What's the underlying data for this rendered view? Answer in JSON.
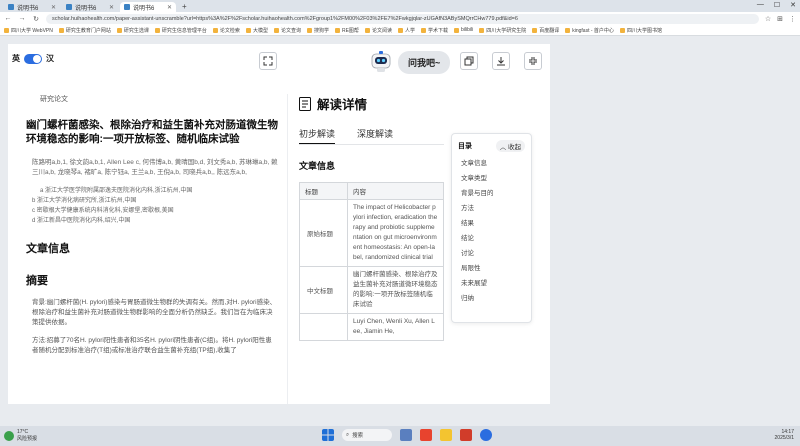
{
  "browser": {
    "tabs": [
      {
        "label": "说明书6",
        "active": false
      },
      {
        "label": "说明书6",
        "active": false
      },
      {
        "label": "说明书6",
        "active": true
      }
    ],
    "url": "scholar.huihaohealth.com/paper-assistant-unscramble?url=https%3A%2F%2Fscholar.huihaohealth.com%2Fgroup1%2FM00%2F03%2FE7%2Fwkgjqlar-zUGAfN3ABySMQrrCHw779.pdf&id=6",
    "bookmarks": [
      "四川大学 WebVPN",
      "研究生教育门户网站",
      "研究生选课",
      "研究生信息管理平台",
      "论文检索",
      "大模型",
      "论文查询",
      "搜狗学",
      "RE图帮",
      "论文阅读",
      "人学",
      "学术下载",
      "bilibili",
      "四川大学研究生院",
      "百度翻译",
      "kingfast - 首户中心",
      "四川大学图书馆"
    ]
  },
  "toolbar": {
    "lang_left": "英",
    "lang_right": "汉",
    "ask_label": "问我吧~"
  },
  "article": {
    "doc_type": "研究论文",
    "title": "幽门螺杆菌感染、根除治疗和益生菌补充对肠道微生物环境稳态的影响:一项开放标签、随机临床试验",
    "authors": "陈路明a,b,1, 徐文韵a,b,1, Allen Lee c, 何伟博a,b, 黄晴国b,d, 刘文秀a,b, 苏琳琳a,b, 赖三川a,b, 龙晓琴a, 褚旷a, 陈宁钰a, 王兰a,b, 王倪a,b, 司晓兵a,b,, 陈远东a,b,",
    "affiliations": [
      "a 浙江大学医学院附属邵逸夫医院消化内科,浙江杭州,中国",
      "b 浙江大学消化病研究所,浙江杭州,中国",
      "c 密歇根大学健康系统内科消化科,安娜堡,密歇根,美国",
      "d 浙江新昌中医院消化内科,绍兴,中国"
    ],
    "section_info": "文章信息",
    "section_abstract": "摘要",
    "abstract_p1": "背景:幽门螺杆菌(H. pylori)感染与胃肠道微生物群的失调有关。然而,对H. pylori感染、根除治疗和益生菌补充对肠道微生物群影响的全面分析仍然缺乏。我们旨在为临床决策提供依据。",
    "abstract_p2": "方法:招募了70名H. pylori阳性患者和35名H. pylori阴性患者(C组)。将H. pylori阳性患者随机分配到标准治疗(T组)或标准治疗联合益生菌补充组(TP组),收集了"
  },
  "detail": {
    "heading": "解读详情",
    "tabs": [
      "初步解读",
      "深度解读"
    ],
    "info_heading": "文章信息",
    "table_headers": [
      "标题",
      "内容"
    ],
    "table_rows": [
      {
        "key": "原始标题",
        "value": "The impact of Helicobacter pylori infection, eradication therapy and probiotic supplementation on gut microenvironment homeostasis: An open-label, randomized clinical trial"
      },
      {
        "key": "中文标题",
        "value": "幽门螺杆菌感染、根除治疗及益生菌补充对肠道微环境稳态的影响:一项开放标签随机临床试验"
      },
      {
        "key": "",
        "value": "Luyi Chen, Wenli Xu, Allen Lee, Jiamin He,"
      }
    ]
  },
  "toc": {
    "title": "目录",
    "collapse_label": "收起",
    "items": [
      "文章信息",
      "文章类型",
      "背景与目的",
      "方法",
      "结果",
      "结论",
      "讨论",
      "局限性",
      "未来展望",
      "归纳"
    ]
  },
  "taskbar": {
    "weather_temp": "17°C",
    "weather_text": "风险预报",
    "search_label": "搜索",
    "time": "14:17",
    "date": "2025/3/1"
  },
  "colors": {
    "accent_blue": "#2b6de0",
    "page_bg": "#e8ebef"
  }
}
